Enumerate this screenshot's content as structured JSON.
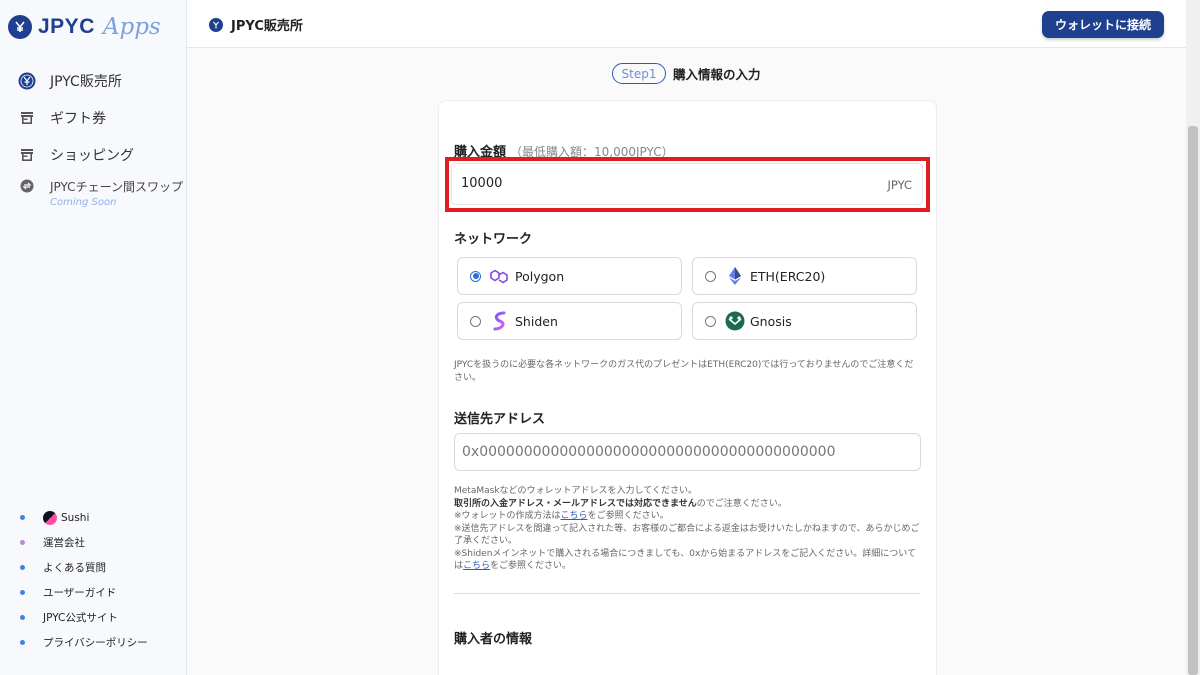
{
  "app": {
    "logo_text": "JPYC",
    "logo_apps": "Apps"
  },
  "sidebar": {
    "items": [
      {
        "label": "JPYC販売所",
        "icon": "jpyc-logo-icon"
      },
      {
        "label": "ギフト券",
        "icon": "store-icon"
      },
      {
        "label": "ショッピング",
        "icon": "store-icon"
      }
    ],
    "swap": {
      "label": "JPYCチェーン間スワップ",
      "badge": "Coming Soon",
      "icon": "swap-icon"
    },
    "footer": [
      {
        "label": "Sushi"
      },
      {
        "label": "運営会社"
      },
      {
        "label": "よくある質問"
      },
      {
        "label": "ユーザーガイド"
      },
      {
        "label": "JPYC公式サイト"
      },
      {
        "label": "プライバシーポリシー"
      }
    ]
  },
  "header": {
    "title": "JPYC販売所",
    "connect_button": "ウォレットに接続"
  },
  "step": {
    "pill": "Step1",
    "title": "購入情報の入力"
  },
  "form": {
    "amount": {
      "label": "購入金額",
      "sub": "（最低購入額：10,000JPYC）",
      "value": "10000",
      "unit": "JPYC"
    },
    "network": {
      "label": "ネットワーク",
      "options": [
        {
          "label": "Polygon",
          "selected": true
        },
        {
          "label": "ETH(ERC20)",
          "selected": false
        },
        {
          "label": "Shiden",
          "selected": false
        },
        {
          "label": "Gnosis",
          "selected": false
        }
      ],
      "note": "JPYCを扱うのに必要な各ネットワークのガス代のプレゼントはETH(ERC20)では行っておりませんのでご注意ください。"
    },
    "address": {
      "label": "送信先アドレス",
      "placeholder": "0x0000000000000000000000000000000000000000",
      "note_line1": "MetaMaskなどのウォレットアドレスを入力してください。",
      "note_line2_bold": "取引所の入金アドレス・メールアドレスでは対応できません",
      "note_line2_rest": "のでご注意ください。",
      "note_line3_pre": "※ウォレットの作成方法は",
      "note_line3_link": "こちら",
      "note_line3_post": "をご参照ください。",
      "note_line4": "※送信先アドレスを間違って記入された等、お客様のご都合による返金はお受けいたしかねますので、あらかじめご了承ください。",
      "note_line5_pre": "※Shidenメインネットで購入される場合につきましても、0xから始まるアドレスをご記入ください。詳細については",
      "note_line5_link": "こちら",
      "note_line5_post": "をご参照ください。"
    },
    "buyer": {
      "label": "購入者の情報"
    }
  },
  "colors": {
    "brand": "#1f3f8f",
    "highlight": "#e01c24",
    "radio": "#2d6fd8"
  }
}
